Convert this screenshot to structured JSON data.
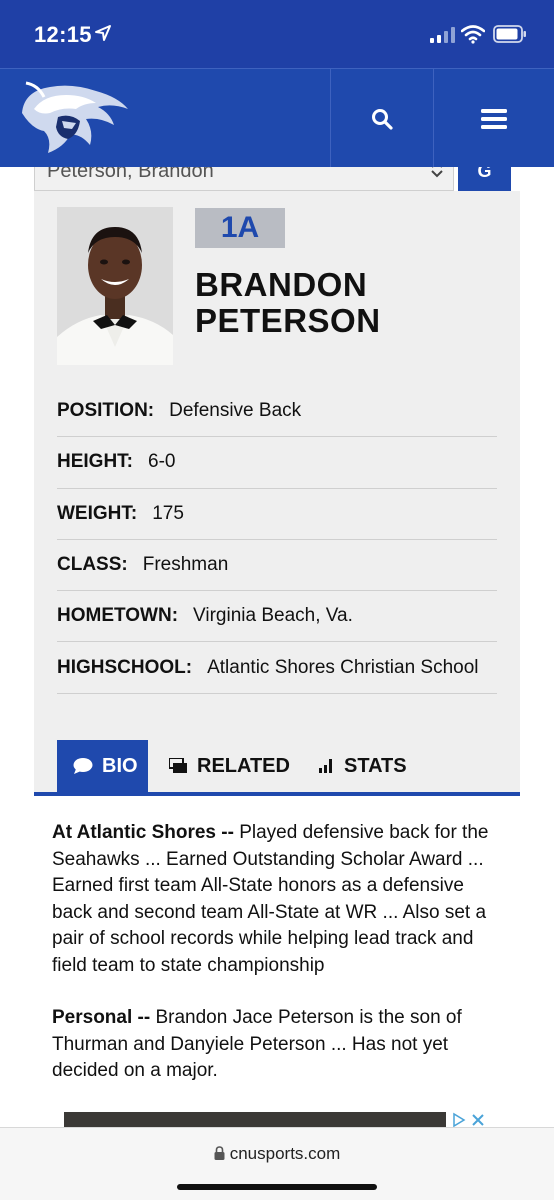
{
  "status_bar": {
    "time": "12:15"
  },
  "header": {
    "logo_icon": "cavalier-helmet-logo",
    "search_icon": "search-icon",
    "menu_icon": "hamburger-menu-icon"
  },
  "roster_select": {
    "selected": "Peterson, Brandon",
    "go_label": "G"
  },
  "player": {
    "jersey": "1A",
    "first_name": "BRANDON",
    "last_name": "PETERSON",
    "facts": [
      {
        "label": "POSITION:",
        "value": "Defensive Back"
      },
      {
        "label": "HEIGHT:",
        "value": "6-0"
      },
      {
        "label": "WEIGHT:",
        "value": "175"
      },
      {
        "label": "CLASS:",
        "value": "Freshman"
      },
      {
        "label": "HOMETOWN:",
        "value": "Virginia Beach, Va."
      },
      {
        "label": "HIGHSCHOOL:",
        "value": "Atlantic Shores Christian School"
      }
    ]
  },
  "tabs": [
    {
      "label": "BIO",
      "icon": "speech-bubble-icon",
      "active": true
    },
    {
      "label": "RELATED",
      "icon": "related-cards-icon",
      "active": false
    },
    {
      "label": "STATS",
      "icon": "bar-chart-icon",
      "active": false
    }
  ],
  "bio": {
    "p1_lead": "At Atlantic Shores --",
    "p1_text": " Played defensive back for the Seahawks ... Earned Outstanding Scholar Award ... Earned first team All-State honors as a defensive back and second team All-State at WR ... Also set a pair of school records while helping lead track and field team to state championship",
    "p2_lead": "Personal --",
    "p2_text": " Brandon Jace Peterson is the son of Thurman and Danyiele Peterson ... Has not yet decided on a major."
  },
  "browser": {
    "url": "cnusports.com"
  },
  "colors": {
    "brand_blue": "#1f49ad",
    "status_blue": "#1f40a6",
    "card_bg": "#efefef",
    "jersey_bg": "#b9bcc3"
  }
}
